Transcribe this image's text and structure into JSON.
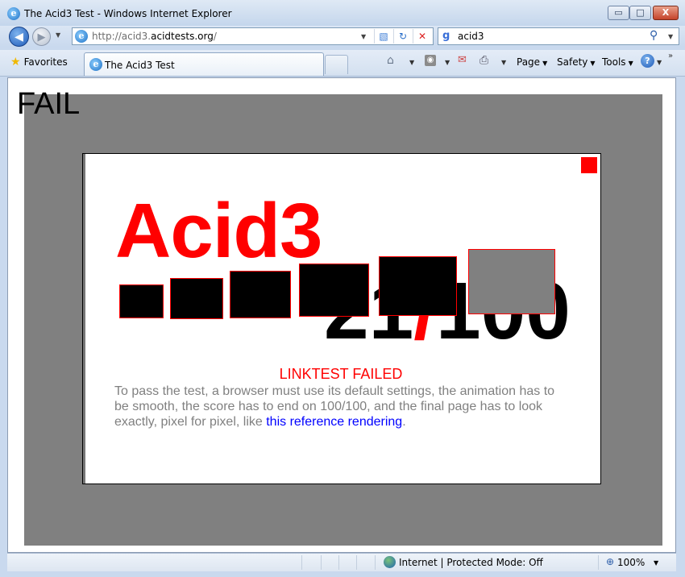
{
  "window": {
    "title": "The Acid3 Test - Windows Internet Explorer",
    "app_icon_glyph": "e",
    "min_glyph": "▭",
    "max_glyph": "□",
    "close_glyph": "X"
  },
  "navbar": {
    "back_glyph": "◀",
    "forward_glyph": "▶",
    "address_prefix": "http://acid3.",
    "address_domain": "acidtests.org",
    "address_suffix": "/",
    "search_provider_glyph": "g",
    "search_query": "acid3"
  },
  "tabbar": {
    "favorites_label": "Favorites",
    "tab_label": "The Acid3 Test",
    "commands": {
      "page": "Page",
      "safety": "Safety",
      "tools": "Tools"
    },
    "help_glyph": "?"
  },
  "page": {
    "status_text": "FAIL",
    "title": "Acid3",
    "score": "21",
    "score_separator": "/",
    "score_total": "100",
    "result_message": "LINKTEST FAILED",
    "instructions_text": "To pass the test, a browser must use its default settings, the animation has to be smooth, the score has to end on 100/100, and the final page has to look exactly, pixel for pixel, like ",
    "reference_link_text": "this reference rendering",
    "instructions_end": "."
  },
  "statusbar": {
    "zone_text": "Internet | Protected Mode: Off",
    "zoom": "100%"
  },
  "colors": {
    "stage_background": "#808080",
    "acid_red": "#ff0000",
    "link_blue": "#0000ff",
    "instruction_gray": "#808080"
  },
  "icons": [
    "ie-icon",
    "back-icon",
    "forward-icon",
    "compat-view-icon",
    "refresh-icon",
    "stop-icon",
    "search-icon",
    "favorites-star-icon",
    "home-icon",
    "rss-icon",
    "mail-icon",
    "print-icon",
    "help-icon",
    "globe-icon",
    "zoom-icon"
  ]
}
